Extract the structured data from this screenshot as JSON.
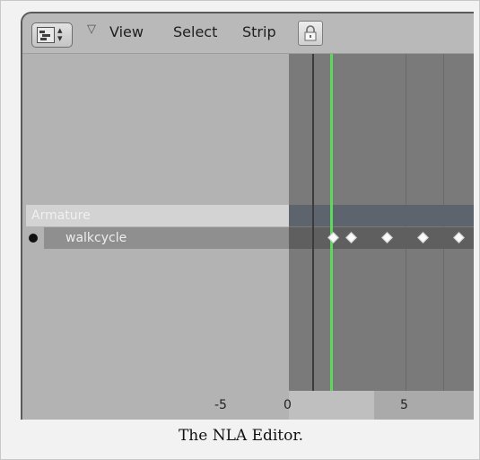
{
  "header": {
    "menus": [
      "View",
      "Select",
      "Strip"
    ],
    "editor_type_icon": "nla-editor-icon",
    "lock_icon": "lock-icon"
  },
  "channels": {
    "object_name": "Armature",
    "action_name": "walkcycle"
  },
  "ruler": {
    "left_tick": "-5",
    "zero_tick": "0",
    "five_tick": "5"
  },
  "caption": "The NLA Editor.",
  "colors": {
    "current_frame": "#5fd75f",
    "keyframe": "#fafafa"
  }
}
